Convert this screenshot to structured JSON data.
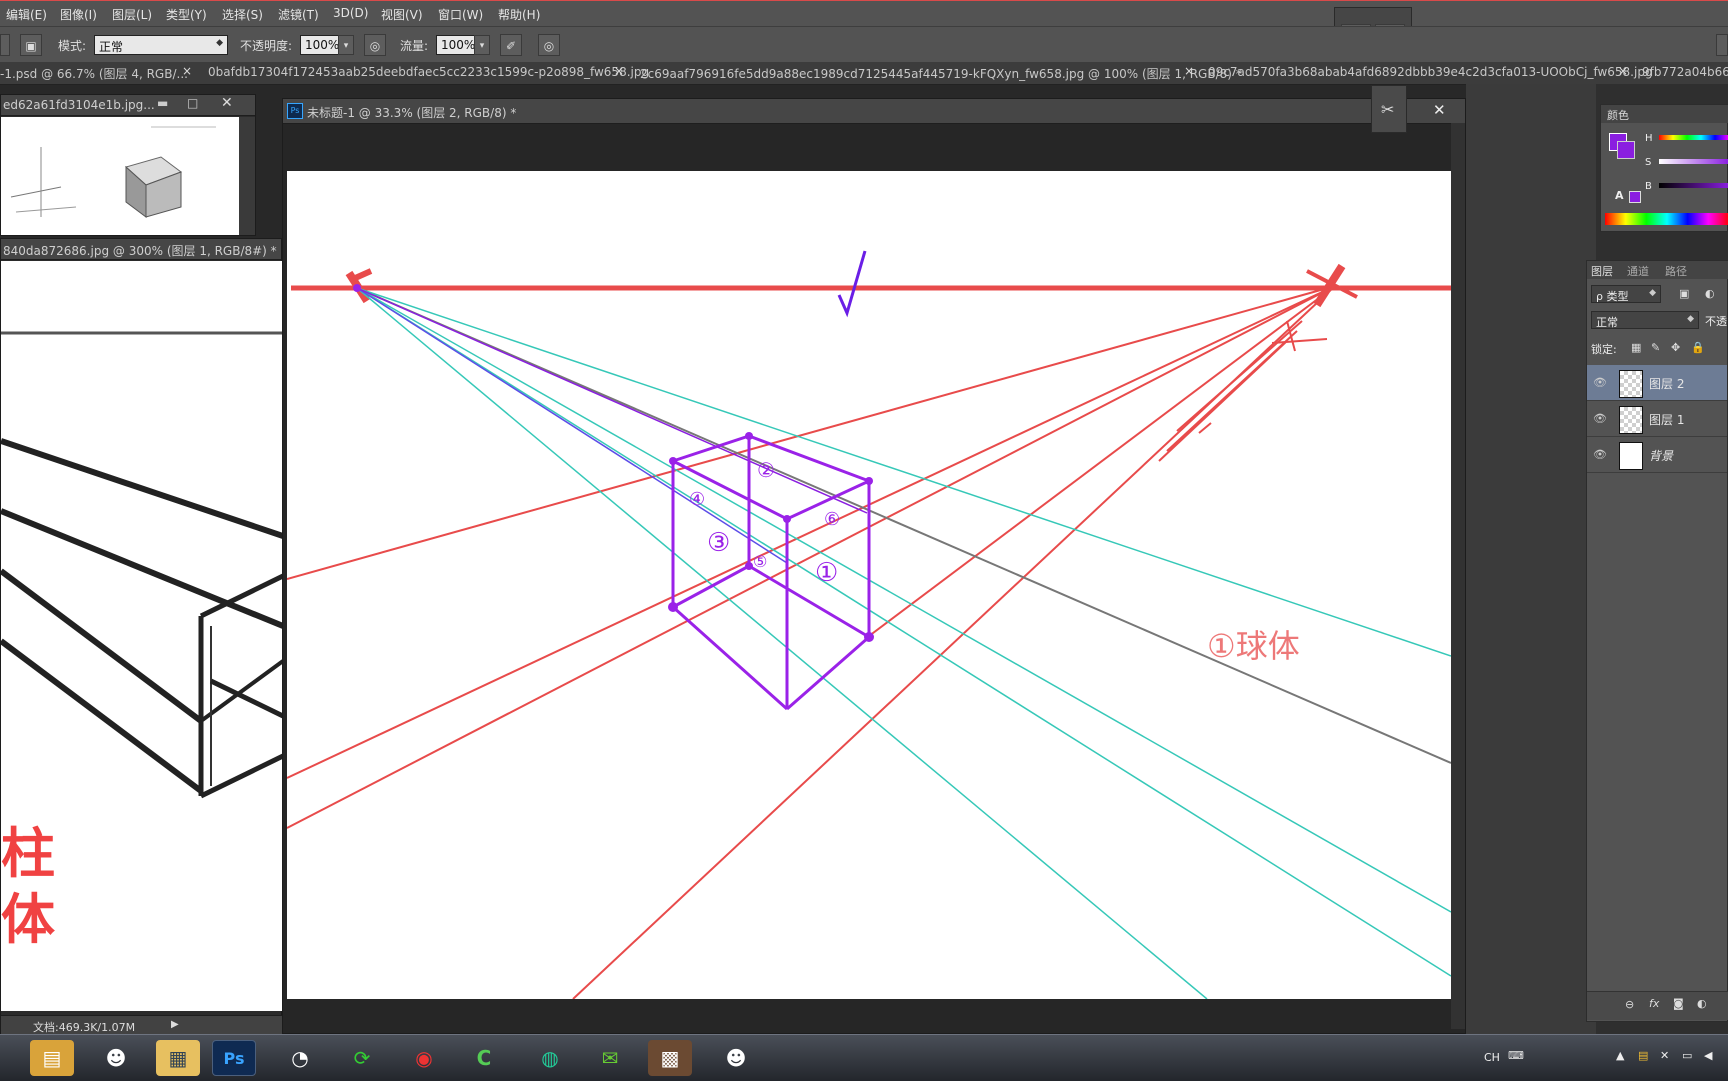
{
  "menu": [
    "编辑(E)",
    "图像(I)",
    "图层(L)",
    "类型(Y)",
    "选择(S)",
    "滤镜(T)",
    "3D(D)",
    "视图(V)",
    "窗口(W)",
    "帮助(H)"
  ],
  "options": {
    "mode_label": "模式:",
    "mode_value": "正常",
    "opacity_label": "不透明度:",
    "opacity_value": "100%",
    "flow_label": "流量:",
    "flow_value": "100%"
  },
  "doc_tabs": [
    "-1.psd @ 66.7% (图层 4, RGB/...",
    "0bafdb17304f172453aab25deebdfaec5cc2233c1599c-p2o898_fw658.jpg",
    "2c69aaf796916fe5dd9a88ec1989cd7125445af445719-kFQXyn_fw658.jpg @ 100% (图层 1, RGB/8) *",
    "09c7ad570fa3b68abab4afd6892dbbb39e4c2d3cfa013-UOObCj_fw658.jpg",
    "9fb772a04b66"
  ],
  "windows": {
    "left_top_title": "ed62a61fd3104e1b.jpg...",
    "left_bottom_title": "840da872686.jpg @ 300% (图层 1, RGB/8#) *",
    "main_title": "未标题-1 @ 33.3% (图层 2, RGB/8) *",
    "ps_badge": "Ps",
    "status_text": "文档:469.3K/1.07M",
    "left_sketch_text": [
      "柱",
      "体"
    ]
  },
  "sketch": {
    "labels": [
      "①球体"
    ]
  },
  "color_panel": {
    "tab": "颜色",
    "h": "H",
    "s": "S",
    "b": "B",
    "fg_color": "#8a1ee0",
    "warn": "A"
  },
  "layers_panel": {
    "tabs": [
      "图层",
      "通道",
      "路径"
    ],
    "filter_value": "ρ 类型",
    "blend_value": "正常",
    "opacity_label": "不透",
    "lock_label": "锁定:",
    "layers": [
      {
        "name": "图层 2",
        "selected": true
      },
      {
        "name": "图层 1",
        "selected": false
      },
      {
        "name": "背景",
        "selected": false
      }
    ]
  },
  "taskbar": {
    "apps": [
      "file-explorer",
      "qq",
      "notepad",
      "photoshop",
      "browser",
      "sync-app",
      "netease-music",
      "camtasia",
      "iqiyi",
      "wechat",
      "image-viewer",
      "qq-2"
    ],
    "ps_label": "Ps",
    "lang": "CH"
  }
}
